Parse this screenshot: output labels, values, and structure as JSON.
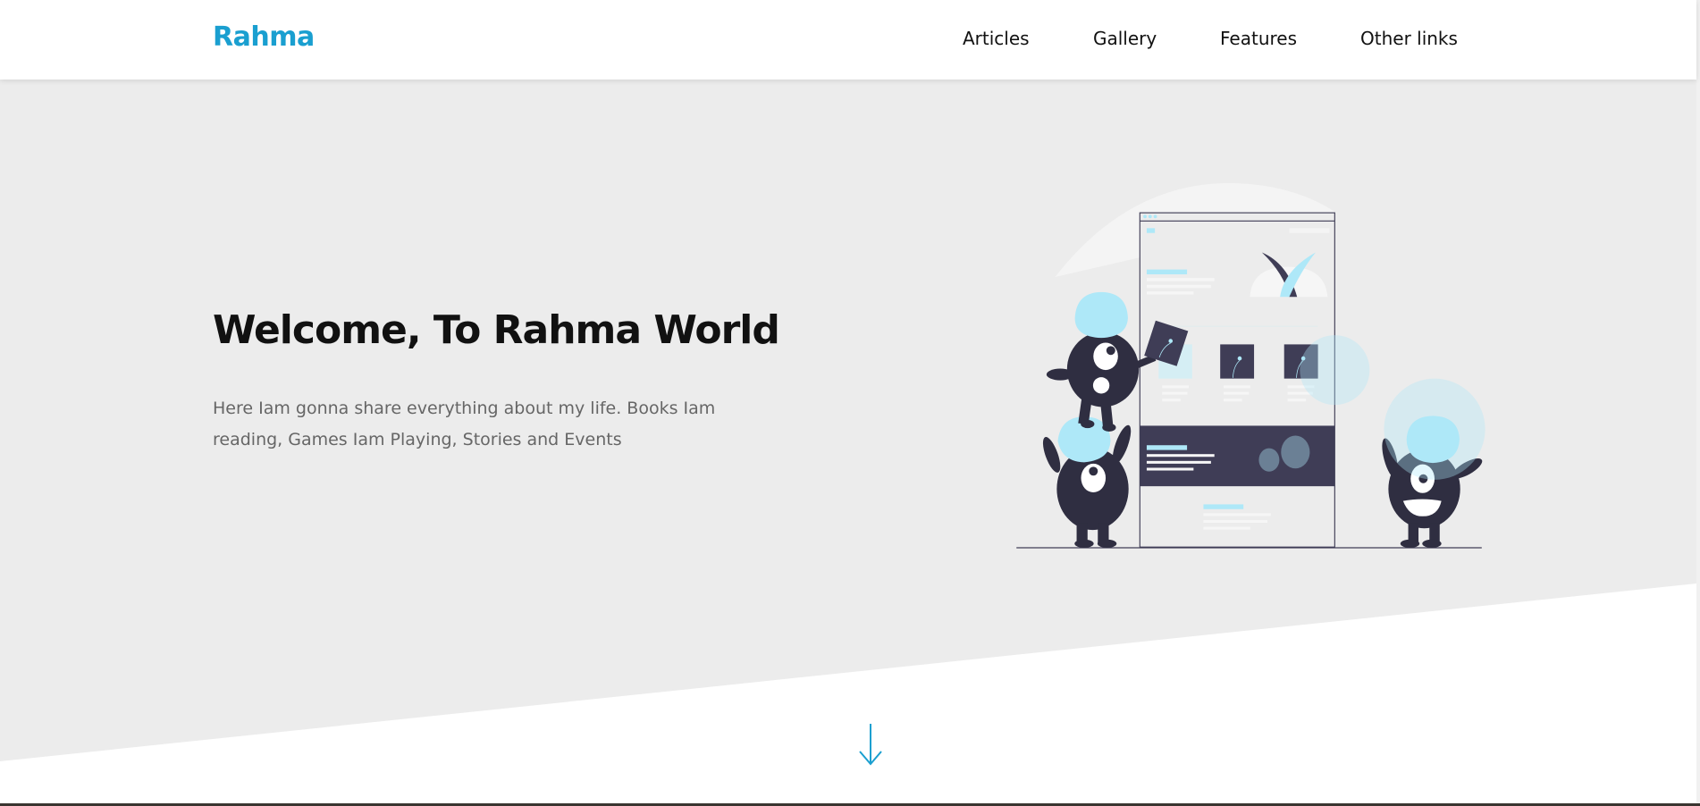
{
  "header": {
    "logo": "Rahma",
    "nav": [
      {
        "label": "Articles"
      },
      {
        "label": "Gallery"
      },
      {
        "label": "Features"
      },
      {
        "label": "Other links"
      }
    ]
  },
  "hero": {
    "title": "Welcome, To Rahma World",
    "description": "Here Iam gonna share everything about my life. Books Iam reading, Games Iam Playing, Stories and Events"
  },
  "colors": {
    "accent": "#1a9fd0",
    "hero_bg": "#ececec",
    "illustration_dark": "#2f2e41",
    "illustration_blue": "#aee8f8"
  },
  "icons": {
    "scroll_down": "arrow-down-icon"
  }
}
